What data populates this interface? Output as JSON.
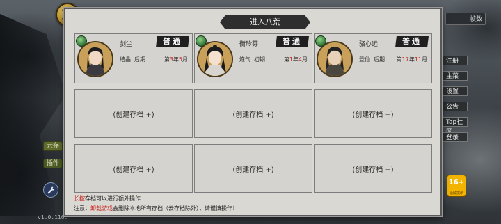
{
  "dialog": {
    "title": "进入八荒",
    "saves": [
      {
        "name": "剑尘",
        "grade": "普通",
        "realm": "结晶",
        "stage": "后期",
        "time_prefix": "第",
        "year": "3",
        "year_unit": "年",
        "month": "5",
        "month_unit": "月"
      },
      {
        "name": "衡玲芬",
        "grade": "普通",
        "realm": "炼气",
        "stage": "初期",
        "time_prefix": "第",
        "year": "1",
        "year_unit": "年",
        "month": "4",
        "month_unit": "月"
      },
      {
        "name": "骆心远",
        "grade": "普通",
        "realm": "登仙",
        "stage": "后期",
        "time_prefix": "第",
        "year": "17",
        "year_unit": "年",
        "month": "11",
        "month_unit": "月"
      }
    ],
    "empty_slot_label": "(创建存档 +)",
    "note_line1": {
      "highlight": "长按",
      "rest": "存档可以进行额外操作"
    },
    "note_line2": {
      "prefix": "注意：",
      "highlight": "卸载游戏",
      "rest": "会删除本地所有存档（云存档除外），请谨慎操作！"
    }
  },
  "left_tags": [
    "云存",
    "插件"
  ],
  "version": "v1.0.116.",
  "right_bar_label": "帧数",
  "right_menu": [
    "注册",
    "主菜",
    "设置",
    "公告",
    "Tap社区",
    "登录"
  ],
  "rating": {
    "age": "16+",
    "text": "适龄提示"
  },
  "colors": {
    "highlight": "#c8201a",
    "grade_bg": "#1f1f1f",
    "panel": "#d9d8d3"
  },
  "icons": {
    "close": "close-x-icon",
    "gem": "jade-gem-icon",
    "wrench": "wrench-icon"
  }
}
